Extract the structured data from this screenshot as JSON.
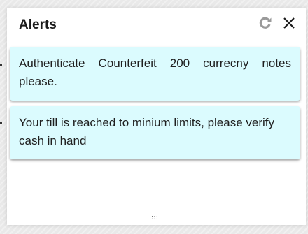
{
  "panel": {
    "title": "Alerts",
    "refresh_icon": "refresh-icon",
    "close_icon": "close-icon"
  },
  "alerts": [
    {
      "message": "Authenticate Counterfeit 200 currecny notes please."
    },
    {
      "message": "Your till is reached to minium limits, please verify cash in hand"
    }
  ],
  "footer": {
    "resize_grip_glyph": ":::"
  }
}
